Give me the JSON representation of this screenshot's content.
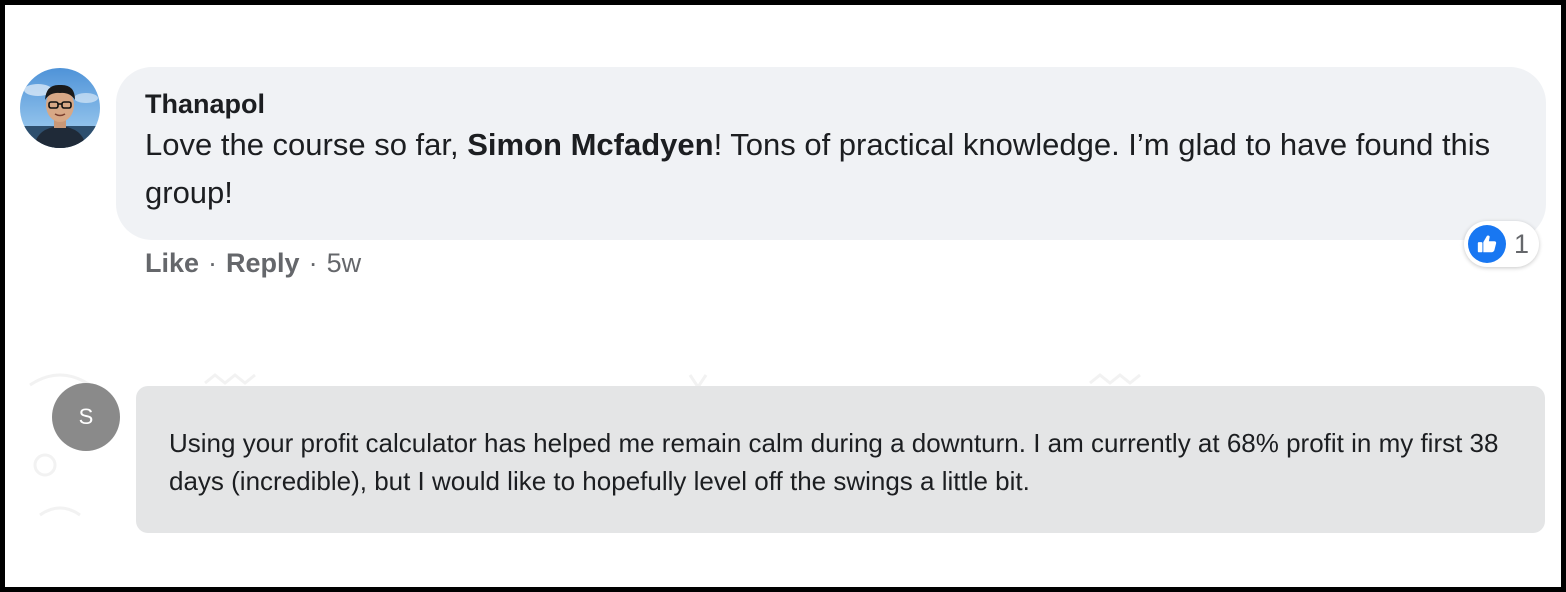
{
  "comment1": {
    "author": "Thanapol",
    "text_before_mention": "Love the course so far, ",
    "mention": "Simon Mcfadyen",
    "text_after_mention": "! Tons of practical knowledge. I’m glad to have found this group!",
    "reaction": {
      "icon": "like-thumb-icon",
      "count": "1",
      "color": "#1877f2"
    },
    "actions": {
      "like": "Like",
      "separator": "·",
      "reply": "Reply",
      "time": "5w"
    }
  },
  "comment2": {
    "avatar_letter": "S",
    "text": "Using your profit calculator has helped me remain calm during a downturn. I am currently at 68% profit in my first 38 days (incredible), but I would like to hopefully level off the swings a little bit."
  }
}
